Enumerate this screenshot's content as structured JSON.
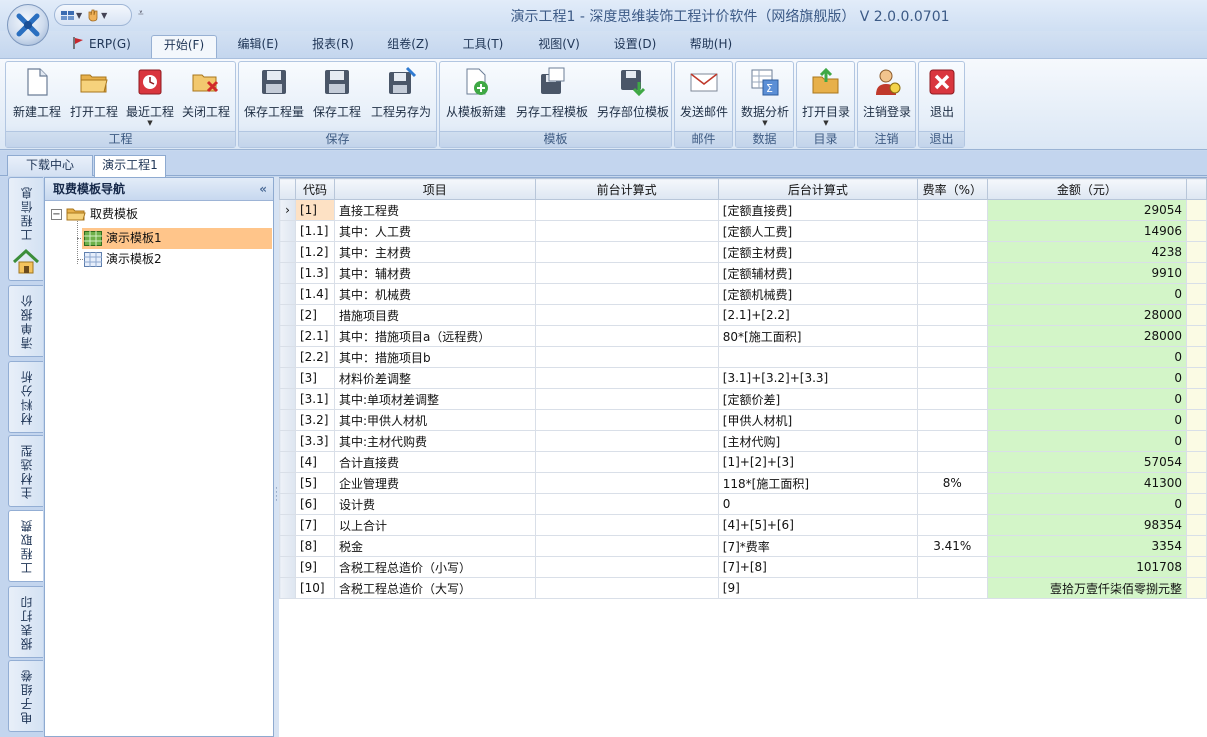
{
  "window": {
    "title": "演示工程1 - 深度思维装饰工程计价软件（网络旗舰版） V 2.0.0.0701",
    "logo_icon": "app-logo-icon"
  },
  "menu": [
    {
      "label": "ERP(G)",
      "icon": "flag-icon"
    },
    {
      "label": "开始(F)"
    },
    {
      "label": "编辑(E)"
    },
    {
      "label": "报表(R)"
    },
    {
      "label": "组卷(Z)"
    },
    {
      "label": "工具(T)"
    },
    {
      "label": "视图(V)"
    },
    {
      "label": "设置(D)"
    },
    {
      "label": "帮助(H)"
    }
  ],
  "active_menu": "开始(F)",
  "ribbon": {
    "groups": [
      {
        "label": "工程",
        "buttons": [
          "新建工程",
          "打开工程",
          "最近工程",
          "关闭工程"
        ]
      },
      {
        "label": "保存",
        "buttons": [
          "保存工程量",
          "保存工程",
          "工程另存为"
        ]
      },
      {
        "label": "模板",
        "buttons": [
          "从模板新建",
          "另存工程模板",
          "另存部位模板"
        ]
      },
      {
        "label": "邮件",
        "buttons": [
          "发送邮件"
        ]
      },
      {
        "label": "数据",
        "buttons": [
          "数据分析"
        ]
      },
      {
        "label": "目录",
        "buttons": [
          "打开目录"
        ]
      },
      {
        "label": "注销",
        "buttons": [
          "注销登录"
        ]
      },
      {
        "label": "退出",
        "buttons": [
          "退出"
        ]
      }
    ]
  },
  "doc_tabs": [
    "下载中心",
    "演示工程1"
  ],
  "active_doc_tab": "演示工程1",
  "side_tabs": [
    "工程信息",
    "清单报价",
    "材料分析",
    "主材选型",
    "工程取费",
    "报表打印",
    "电子组卷"
  ],
  "active_side_tab": "工程取费",
  "nav": {
    "title": "取费模板导航",
    "collapse": "«",
    "root": "取费模板",
    "children": [
      "演示模板1",
      "演示模板2"
    ],
    "selected": "演示模板1"
  },
  "grid": {
    "columns": [
      "代码",
      "项目",
      "前台计算式",
      "后台计算式",
      "费率（%）",
      "金额（元）"
    ],
    "rows": [
      {
        "code": "[1]",
        "item": "直接工程费",
        "front": "",
        "back": "[定额直接费]",
        "rate": "",
        "amount": "29054"
      },
      {
        "code": "[1.1]",
        "item": "其中：人工费",
        "front": "",
        "back": "[定额人工费]",
        "rate": "",
        "amount": "14906"
      },
      {
        "code": "[1.2]",
        "item": "其中：主材费",
        "front": "",
        "back": "[定额主材费]",
        "rate": "",
        "amount": "4238"
      },
      {
        "code": "[1.3]",
        "item": "其中：辅材费",
        "front": "",
        "back": "[定额辅材费]",
        "rate": "",
        "amount": "9910"
      },
      {
        "code": "[1.4]",
        "item": "其中：机械费",
        "front": "",
        "back": "[定额机械费]",
        "rate": "",
        "amount": "0"
      },
      {
        "code": "[2]",
        "item": "措施项目费",
        "front": "",
        "back": "[2.1]+[2.2]",
        "rate": "",
        "amount": "28000"
      },
      {
        "code": "[2.1]",
        "item": "其中：措施项目a（远程费）",
        "front": "",
        "back": "80*[施工面积]",
        "rate": "",
        "amount": "28000"
      },
      {
        "code": "[2.2]",
        "item": "其中：措施项目b",
        "front": "",
        "back": "",
        "rate": "",
        "amount": "0"
      },
      {
        "code": "[3]",
        "item": "材料价差调整",
        "front": "",
        "back": "[3.1]+[3.2]+[3.3]",
        "rate": "",
        "amount": "0"
      },
      {
        "code": "[3.1]",
        "item": "其中:单项材差调整",
        "front": "",
        "back": "[定额价差]",
        "rate": "",
        "amount": "0"
      },
      {
        "code": "[3.2]",
        "item": "其中:甲供人材机",
        "front": "",
        "back": "[甲供人材机]",
        "rate": "",
        "amount": "0"
      },
      {
        "code": "[3.3]",
        "item": "其中:主材代购费",
        "front": "",
        "back": "[主材代购]",
        "rate": "",
        "amount": "0"
      },
      {
        "code": "[4]",
        "item": "合计直接费",
        "front": "",
        "back": "[1]+[2]+[3]",
        "rate": "",
        "amount": "57054"
      },
      {
        "code": "[5]",
        "item": "企业管理费",
        "front": "",
        "back": "118*[施工面积]",
        "rate": "8%",
        "amount": "41300"
      },
      {
        "code": "[6]",
        "item": "设计费",
        "front": "",
        "back": "0",
        "rate": "",
        "amount": "0"
      },
      {
        "code": "[7]",
        "item": "以上合计",
        "front": "",
        "back": "[4]+[5]+[6]",
        "rate": "",
        "amount": "98354"
      },
      {
        "code": "[8]",
        "item": "税金",
        "front": "",
        "back": "[7]*费率",
        "rate": "3.41%",
        "amount": "3354"
      },
      {
        "code": "[9]",
        "item": "含税工程总造价（小写）",
        "front": "",
        "back": "[7]+[8]",
        "rate": "",
        "amount": "101708"
      },
      {
        "code": "[10]",
        "item": "含税工程总造价（大写）",
        "front": "",
        "back": "[9]",
        "rate": "",
        "amount": "壹拾万壹仟柒佰零捌元整"
      }
    ],
    "current_row_marker": "›"
  },
  "colors": {
    "amount_bg": "#d3f5c8",
    "selected_code_bg": "#fde1c4",
    "selected_tree_bg": "#ffc58a",
    "ribbon_accent": "#3d5a82"
  }
}
